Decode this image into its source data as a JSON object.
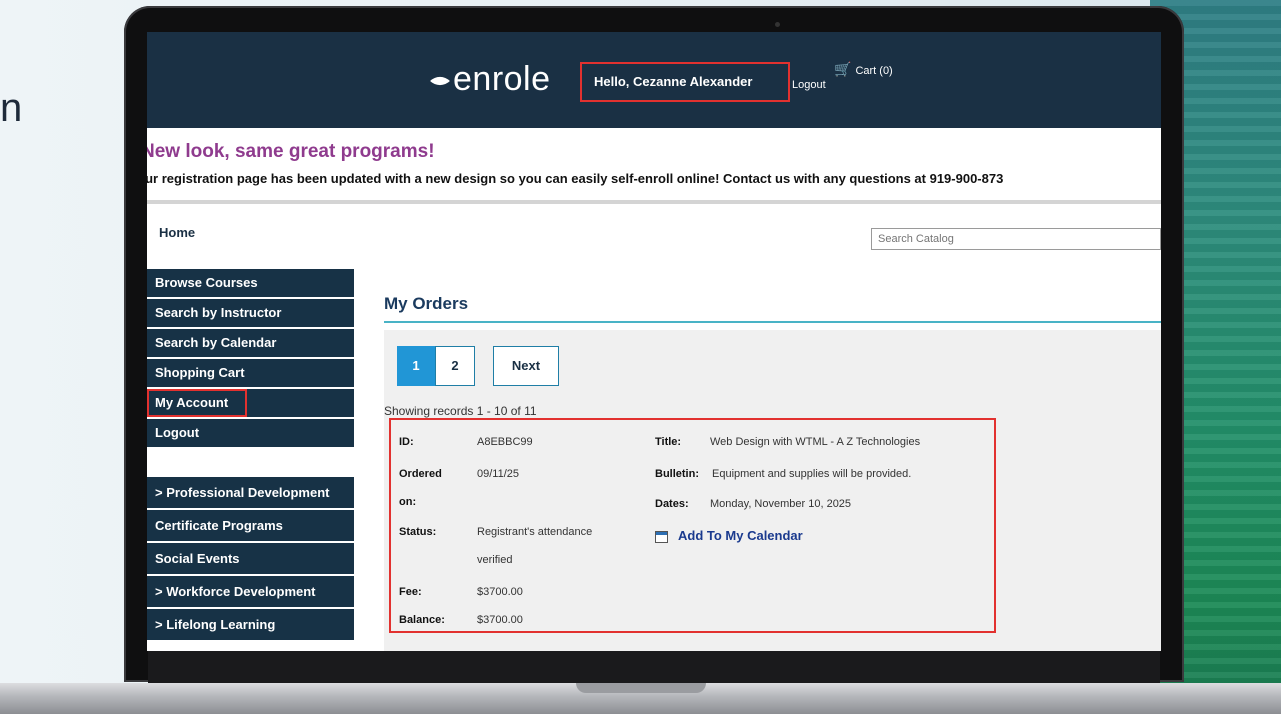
{
  "background_text": "n",
  "header": {
    "logo": "enrole",
    "greeting": "Hello,  Cezanne  Alexander",
    "logout": "Logout",
    "cart": "Cart (0)"
  },
  "banner": {
    "title": "New look, same great programs!",
    "text": "Our registration page has been updated with a new design so you can easily self-enroll online! Contact us with any questions at 919-900-873"
  },
  "nav": {
    "home": "Home",
    "search_placeholder": "Search Catalog"
  },
  "sidebar": {
    "items": [
      {
        "label": "Browse Courses"
      },
      {
        "label": "Search by Instructor"
      },
      {
        "label": "Search by Calendar"
      },
      {
        "label": "Shopping Cart"
      },
      {
        "label": "My Account",
        "highlighted": true
      },
      {
        "label": "Logout"
      }
    ],
    "categories": [
      {
        "label": "> Professional Development"
      },
      {
        "label": "Certificate Programs"
      },
      {
        "label": "Social Events"
      },
      {
        "label": "> Workforce Development"
      },
      {
        "label": "> Lifelong Learning"
      }
    ]
  },
  "main": {
    "title": "My Orders",
    "pager": {
      "pages": [
        "1",
        "2"
      ],
      "current": "1",
      "next": "Next"
    },
    "showing": "Showing records 1 - 10 of 11",
    "order": {
      "id_label": "ID:",
      "id": "A8EBBC99",
      "ordered_label_1": "Ordered",
      "ordered_label_2": "on:",
      "ordered": "09/11/25",
      "status_label": "Status:",
      "status_1": "Registrant's attendance",
      "status_2": "verified",
      "fee_label": "Fee:",
      "fee": "$3700.00",
      "balance_label": "Balance:",
      "balance": "$3700.00",
      "title_label": "Title:",
      "title": "Web Design with WTML - A Z Technologies",
      "bulletin_label": "Bulletin:",
      "bulletin": "Equipment and supplies will be provided.",
      "dates_label": "Dates:",
      "dates": "Monday, November 10, 2025",
      "calendar_link": "Add To My Calendar"
    }
  },
  "colors": {
    "header_bg": "#1a3044",
    "banner_title": "#8f3b8e",
    "accent_rule": "#49b3c6",
    "active_page": "#2196d6",
    "highlight_border": "#e2312f"
  },
  "icons": {
    "cart": "cart-icon",
    "logo": "leaf-icon",
    "calendar": "calendar-icon"
  }
}
